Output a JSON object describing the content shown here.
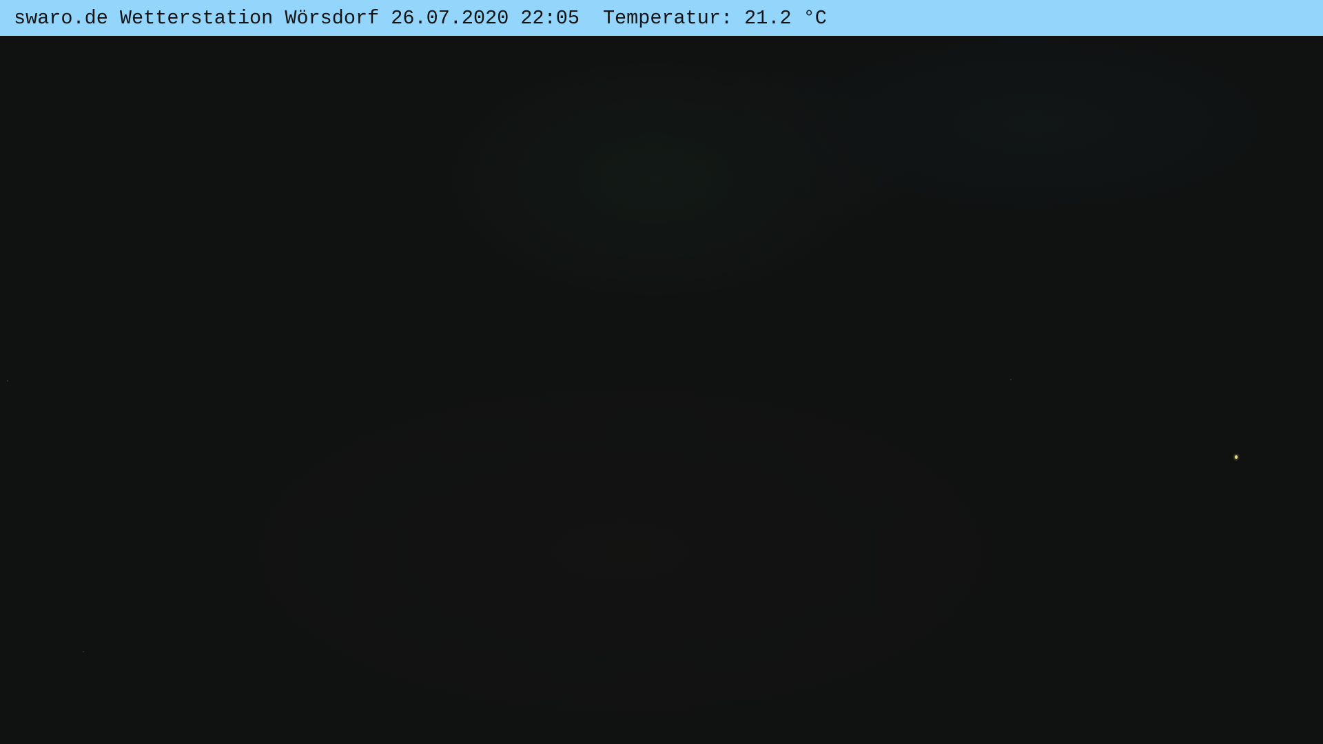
{
  "overlay": {
    "station_text": "swaro.de Wetterstation Wörsdorf 26.07.2020 22:05",
    "temperature_text": "Temperatur: 21.2 °C"
  },
  "colors": {
    "overlay_background": "#94d5fb",
    "overlay_text": "#141414",
    "night_sky": "#101111",
    "distant_light": "#e8e07a"
  }
}
